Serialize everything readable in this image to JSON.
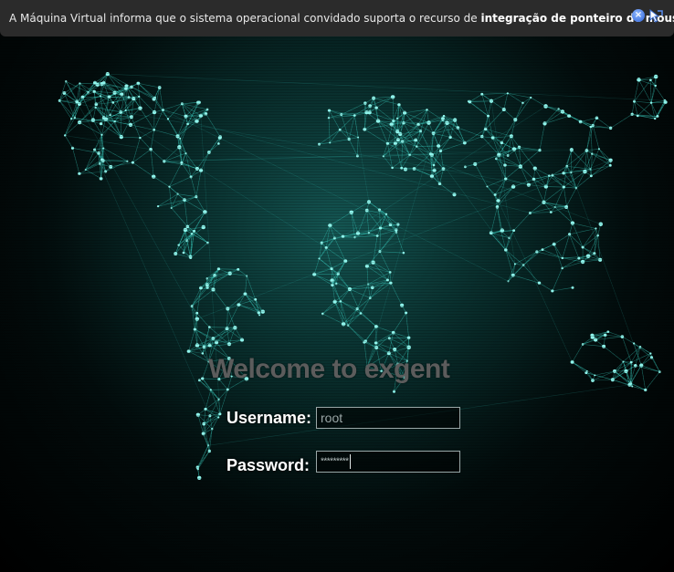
{
  "notification": {
    "text_prefix": "A Máquina Virtual informa que o sistema operacional convidado suporta o recurso de ",
    "text_bold": "integração de ponteiro de mouse",
    "text_suffix": ".",
    "close_icon": "close-icon",
    "mouse_integration_icon": "mouse-pointer-icon"
  },
  "login": {
    "welcome": "Welcome to exgent",
    "username_label": "Username:",
    "username_value": "root",
    "password_label": "Password:",
    "password_value": "*********"
  },
  "colors": {
    "accent": "#3fe0d0",
    "notification_bg": "#2b2b2b",
    "background": "#000000"
  }
}
